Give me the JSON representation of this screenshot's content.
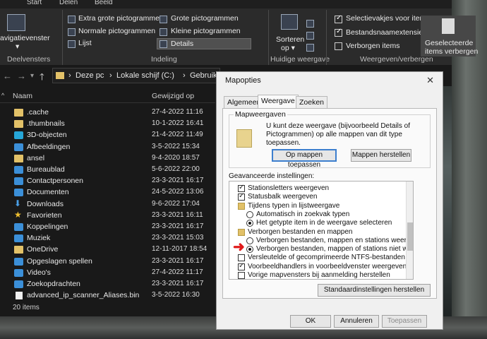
{
  "ribbon": {
    "tabs": [
      "Start",
      "Delen",
      "Beeld"
    ],
    "navpane_label": "avigatievenster",
    "navpane_arrow": "▾",
    "group_panes": "Deelvensters",
    "layout_items": {
      "extra_large": "Extra grote pictogrammen",
      "large": "Grote pictogrammen",
      "normal": "Normale pictogrammen",
      "small": "Kleine pictogrammen",
      "list": "Lijst",
      "details": "Details"
    },
    "group_layout": "Indeling",
    "sort_label_1": "Sorteren",
    "sort_label_2": "op ▾",
    "group_current_view": "Huidige weergave",
    "show_hide": {
      "item_checkboxes": "Selectievakjes voor items",
      "extensions": "Bestandsnaamextensies",
      "hidden_items": "Verborgen items"
    },
    "hide_selected_1": "Geselecteerde",
    "hide_selected_2": "items verbergen",
    "group_show_hide": "Weergeven/verbergen"
  },
  "address": {
    "crumbs": [
      "Deze pc",
      "Lokale schijf (C:)",
      "Gebruikers"
    ],
    "separator": "›",
    "back": "←",
    "forward": "→",
    "recent": "▾",
    "up": "🡑"
  },
  "filelist": {
    "col_name": "Naam",
    "col_modified": "Gewijzigd op",
    "rows": [
      {
        "name": ".cache",
        "date": "27-4-2022 11:16",
        "icon": "folder"
      },
      {
        "name": ".thumbnails",
        "date": "10-1-2022 16:41",
        "icon": "folder"
      },
      {
        "name": "3D-objecten",
        "date": "21-4-2022 11:49",
        "icon": "cyan"
      },
      {
        "name": "Afbeeldingen",
        "date": "3-5-2022 15:34",
        "icon": "blue"
      },
      {
        "name": "ansel",
        "date": "9-4-2020 18:57",
        "icon": "folder"
      },
      {
        "name": "Bureaublad",
        "date": "5-6-2022 22:00",
        "icon": "blue"
      },
      {
        "name": "Contactpersonen",
        "date": "23-3-2021 16:17",
        "icon": "blue"
      },
      {
        "name": "Documenten",
        "date": "24-5-2022 13:06",
        "icon": "blue"
      },
      {
        "name": "Downloads",
        "date": "9-6-2022 17:04",
        "icon": "download"
      },
      {
        "name": "Favorieten",
        "date": "23-3-2021 16:11",
        "icon": "star"
      },
      {
        "name": "Koppelingen",
        "date": "23-3-2021 16:17",
        "icon": "blue"
      },
      {
        "name": "Muziek",
        "date": "23-3-2021 15:03",
        "icon": "blue"
      },
      {
        "name": "OneDrive",
        "date": "12-11-2017 18:54",
        "icon": "folder"
      },
      {
        "name": "Opgeslagen spellen",
        "date": "23-3-2021 16:17",
        "icon": "blue"
      },
      {
        "name": "Video's",
        "date": "27-4-2022 11:17",
        "icon": "blue"
      },
      {
        "name": "Zoekopdrachten",
        "date": "23-3-2021 16:17",
        "icon": "blue"
      },
      {
        "name": "advanced_ip_scanner_Aliases.bin",
        "date": "3-5-2022 16:30",
        "icon": "file"
      }
    ],
    "status": "20 items"
  },
  "dialog": {
    "title": "Mapopties",
    "close": "✕",
    "tabs": [
      "Algemeen",
      "Weergave",
      "Zoeken"
    ],
    "folder_views_legend": "Mapweergaven",
    "folder_views_desc": "U kunt deze weergave (bijvoorbeeld Details of Pictogrammen) op alle mappen van dit type toepassen.",
    "apply_btn": "Op mappen toepassen",
    "reset_btn": "Mappen herstellen",
    "advanced_label": "Geavanceerde instellingen:",
    "tree": [
      {
        "text": "Stationsletters weergeven",
        "mark": "check",
        "on": true,
        "indent": 0
      },
      {
        "text": "Statusbalk weergeven",
        "mark": "check",
        "on": true,
        "indent": 0
      },
      {
        "text": "Tijdens typen in lijstweergave",
        "mark": "folder",
        "on": false,
        "indent": 0
      },
      {
        "text": "Automatisch in zoekvak typen",
        "mark": "radio",
        "on": false,
        "indent": 1
      },
      {
        "text": "Het getypte item in de weergave selecteren",
        "mark": "radio",
        "on": true,
        "indent": 1
      },
      {
        "text": "Verborgen bestanden en mappen",
        "mark": "folder",
        "on": false,
        "indent": 0
      },
      {
        "text": "Verborgen bestanden, mappen en stations weergeven",
        "mark": "radio",
        "on": false,
        "indent": 1
      },
      {
        "text": "Verborgen bestanden, mappen of stations niet weergeven",
        "mark": "radio",
        "on": true,
        "indent": 1
      },
      {
        "text": "Versleutelde of gecomprimeerde NTFS-bestanden in een",
        "mark": "check",
        "on": false,
        "indent": 0
      },
      {
        "text": "Voorbeeldhandlers in voorbeeldvenster weergeven",
        "mark": "check",
        "on": true,
        "indent": 0
      },
      {
        "text": "Vorige mapvensters bij aanmelding herstellen",
        "mark": "check",
        "on": false,
        "indent": 0
      }
    ],
    "defaults_btn": "Standaardinstellingen herstellen",
    "ok": "OK",
    "cancel": "Annuleren",
    "apply": "Toepassen"
  },
  "annotation": {
    "arrow": "➜",
    "color": "#e01a1a"
  }
}
